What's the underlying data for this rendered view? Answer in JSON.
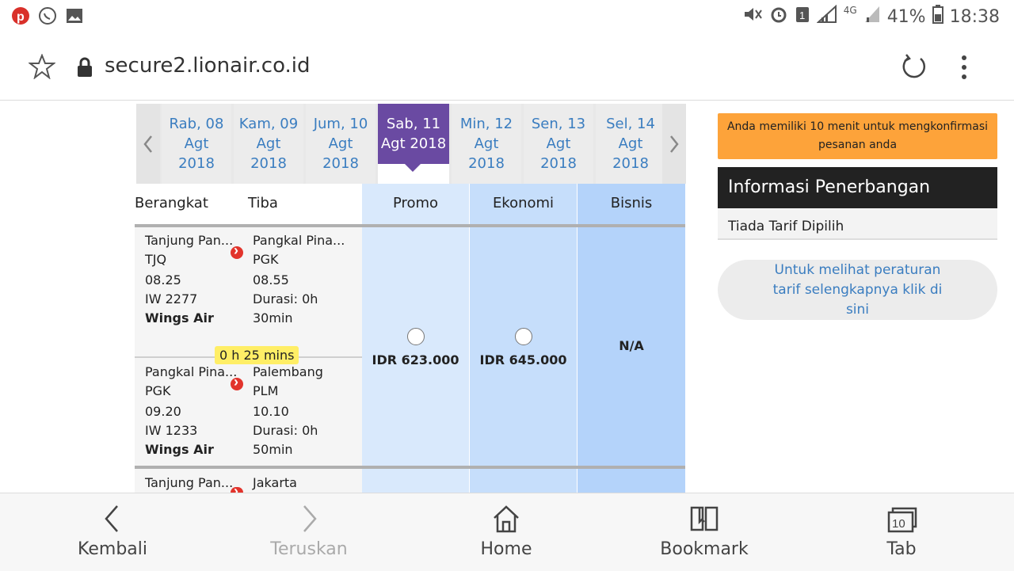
{
  "status_bar": {
    "battery": "41%",
    "time": "18:38",
    "network": "4G",
    "sim": "1"
  },
  "browser": {
    "url": "secure2.lionair.co.id"
  },
  "dates": {
    "items": [
      {
        "line1": "Rab, 08",
        "line2": "Agt",
        "line3": "2018"
      },
      {
        "line1": "Kam, 09",
        "line2": "Agt",
        "line3": "2018"
      },
      {
        "line1": "Jum, 10",
        "line2": "Agt",
        "line3": "2018"
      },
      {
        "line1": "Sab, 11",
        "line2": "Agt 2018",
        "line3": ""
      },
      {
        "line1": "Min, 12",
        "line2": "Agt",
        "line3": "2018"
      },
      {
        "line1": "Sen, 13",
        "line2": "Agt",
        "line3": "2018"
      },
      {
        "line1": "Sel, 14",
        "line2": "Agt",
        "line3": "2018"
      }
    ]
  },
  "table": {
    "depart_label": "Berangkat",
    "arrive_label": "Tiba",
    "promo_label": "Promo",
    "economy_label": "Ekonomi",
    "business_label": "Bisnis"
  },
  "flight1": {
    "seg1": {
      "from_city": "Tanjung Pan...",
      "from_code": "TJQ",
      "dep_time": "08.25",
      "flight_no": "IW 2277",
      "airline": "Wings Air",
      "to_city": "Pangkal Pina...",
      "to_code": "PGK",
      "arr_time": "08.55",
      "duration1": "Durasi: 0h",
      "duration2": "30min"
    },
    "transit": "0 h 25 mins",
    "seg2": {
      "from_city": "Pangkal Pina...",
      "from_code": "PGK",
      "dep_time": "09.20",
      "flight_no": "IW 1233",
      "airline": "Wings Air",
      "to_city": "Palembang",
      "to_code": "PLM",
      "arr_time": "10.10",
      "duration1": "Durasi: 0h",
      "duration2": "50min"
    },
    "promo_price": "IDR 623.000",
    "economy_price": "IDR 645.000",
    "business_price": "N/A"
  },
  "flight2": {
    "from_city": "Tanjung Pan...",
    "to_city": "Jakarta"
  },
  "side": {
    "notice": "Anda memiliki 10 menit untuk mengkonfirmasi pesanan anda",
    "info_title": "Informasi Penerbangan",
    "info_body": "Tiada Tarif Dipilih",
    "fare_link": "Untuk melihat peraturan tarif selengkapnya klik di sini"
  },
  "nav": {
    "back": "Kembali",
    "forward": "Teruskan",
    "home": "Home",
    "bookmark": "Bookmark",
    "tab": "Tab",
    "tab_count": "10"
  }
}
